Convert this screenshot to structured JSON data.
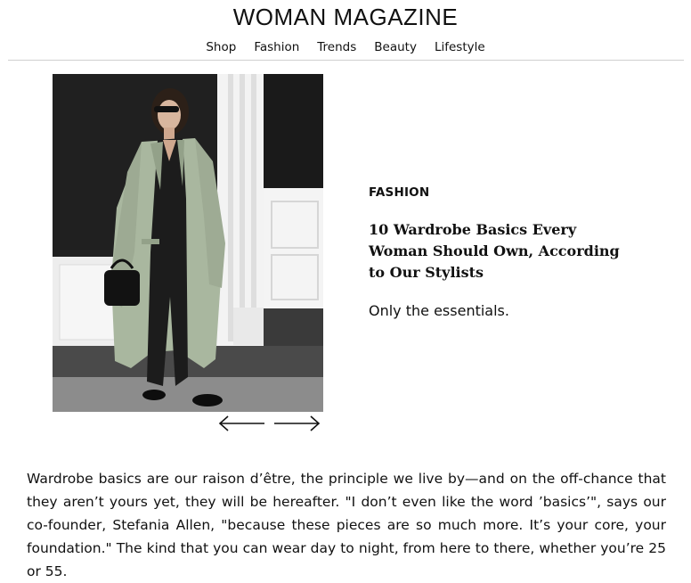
{
  "site": {
    "title": "WOMAN MAGAZINE"
  },
  "nav": {
    "items": [
      "Shop",
      "Fashion",
      "Trends",
      "Beauty",
      "Lifestyle"
    ]
  },
  "carousel": {
    "prev_icon": "arrow-left-icon",
    "next_icon": "arrow-right-icon"
  },
  "article": {
    "category": "FASHION",
    "headline": "10 Wardrobe Basics Every Woman Should Own, According to Our Stylists",
    "dek": "Only the essentials.",
    "body": "Wardrobe basics are our raison d’être, the principle we live by—and on the off-chance that they aren’t yours yet, they will be hereafter. \"I don’t even like the word ’basics’\", says our co-founder, Stefania Allen, \"because these pieces are so much more. It’s your core, your foundation.\" The kind that you can wear day to night, from here to there, whether you’re 25 or 55."
  }
}
